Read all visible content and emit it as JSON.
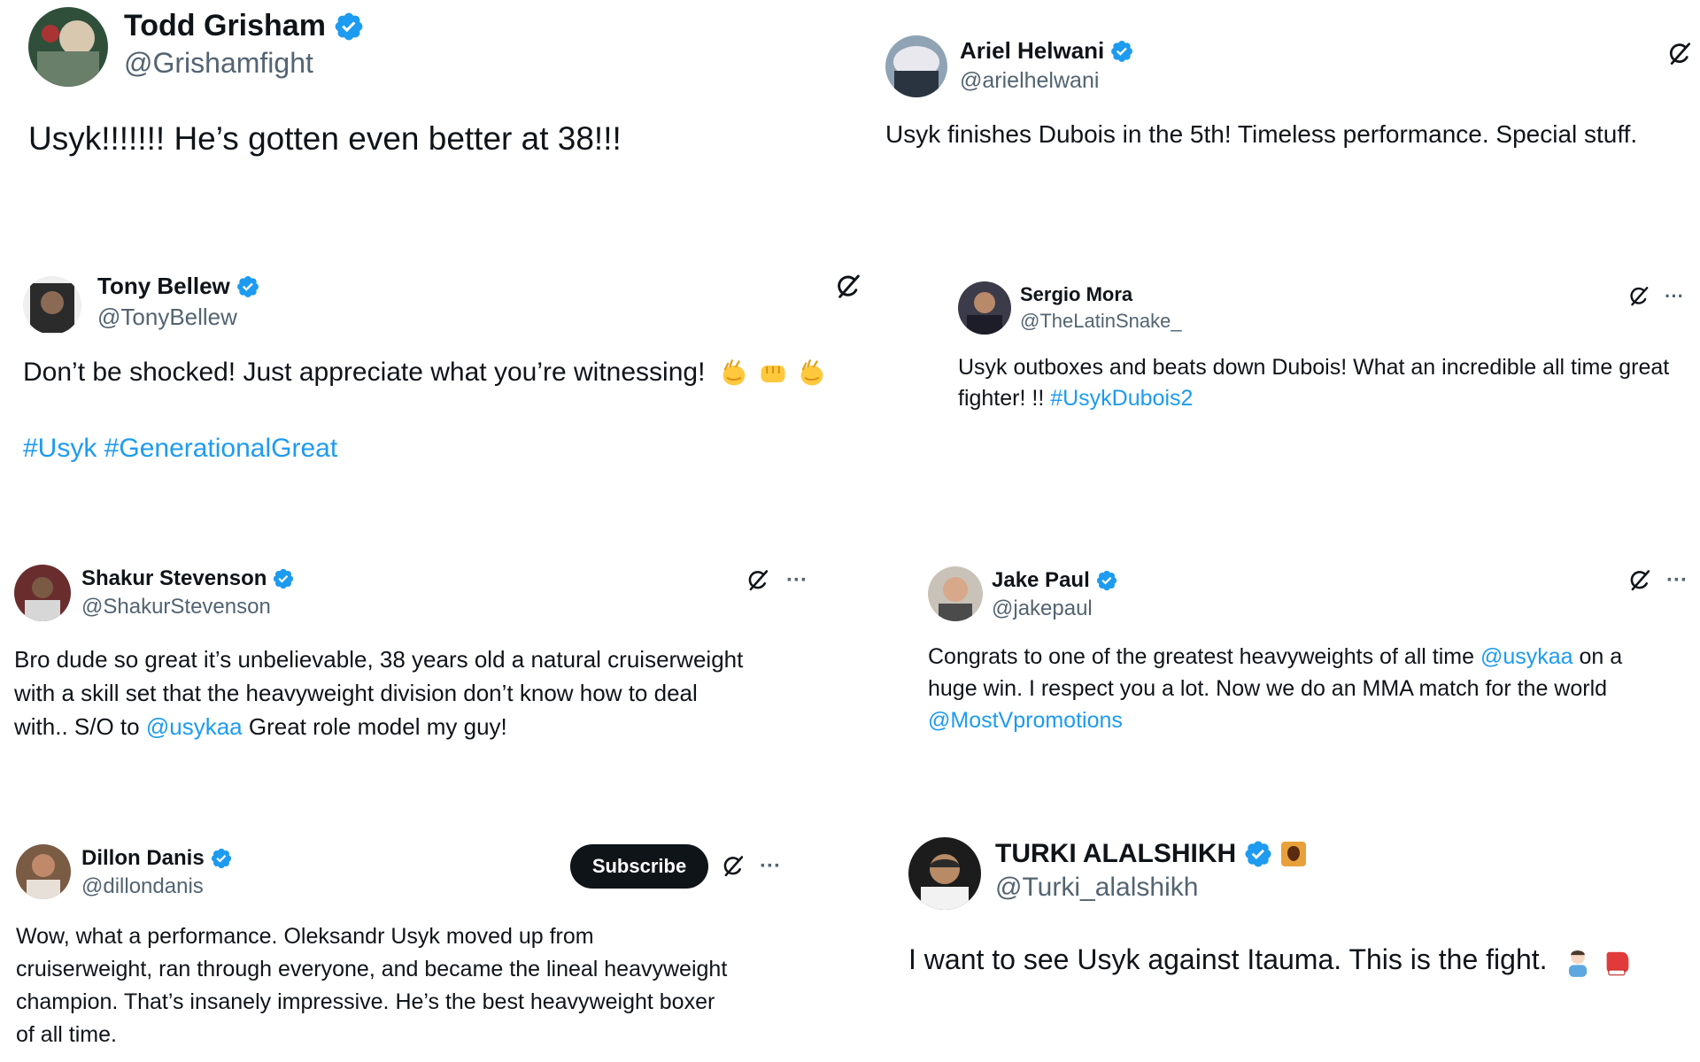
{
  "colors": {
    "link": "#1d9bf0",
    "verified": "#1d9bf0",
    "text": "#0f1419",
    "secondary": "#536471"
  },
  "tweets": [
    {
      "name": "Todd Grisham",
      "handle": "@Grishamfight",
      "text": "Usyk!!!!!!! He’s gotten even better at 38!!!"
    },
    {
      "name": "Ariel Helwani",
      "handle": "@arielhelwani",
      "text": "Usyk finishes Dubois in the 5th! Timeless performance. Special stuff."
    },
    {
      "name": "Tony Bellew",
      "handle": "@TonyBellew",
      "text": "Don’t be shocked! Just appreciate what you’re witnessing!",
      "hashtags": "#Usyk #GenerationalGreat"
    },
    {
      "name": "Sergio Mora",
      "handle": "@TheLatinSnake_",
      "text": "Usyk outboxes and beats down Dubois! What an incredible all time great fighter! !!",
      "hashtag": "#UsykDubois2"
    },
    {
      "name": "Shakur Stevenson",
      "handle": "@ShakurStevenson",
      "text_1": "Bro dude so great it’s unbelievable, 38 years old a natural cruiserweight",
      "text_2": "with a skill set that the heavyweight division don’t know how to deal",
      "text_3": "with.. S/O to",
      "mention": "@usykaa",
      "text_4": "Great role model my guy!"
    },
    {
      "name": "Jake Paul",
      "handle": "@jakepaul",
      "text_1": "Congrats to one of the greatest heavyweights of all time",
      "mention_1": "@usykaa",
      "text_2": "on a",
      "text_3": "huge win. I respect you a lot. Now we do an MMA match for the world",
      "mention_2": "@MostVpromotions"
    },
    {
      "name": "Dillon Danis",
      "handle": "@dillondanis",
      "subscribe": "Subscribe",
      "text_1": "Wow, what a performance. Oleksandr Usyk moved up from",
      "text_2": "cruiserweight, ran through everyone, and became the lineal heavyweight",
      "text_3": "champion. That’s insanely impressive. He’s the best heavyweight boxer",
      "text_4": "of all time."
    },
    {
      "name": "TURKI ALALSHIKH",
      "handle": "@Turki_alalshikh",
      "text": "I want to see Usyk against Itauma. This is the fight."
    }
  ],
  "icons": {
    "verified": "verified-badge-icon",
    "grok": "grok-icon",
    "more": "more-icon",
    "more_glyph": "···"
  }
}
